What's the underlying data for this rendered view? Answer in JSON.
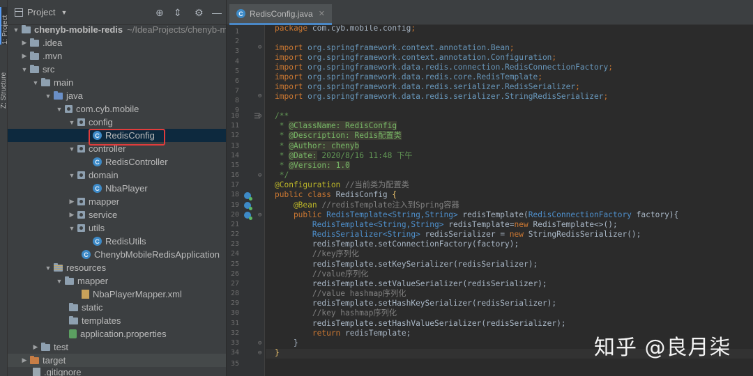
{
  "tool_strip": {
    "project_label": "1: Project",
    "structure_label": "Z: Structure"
  },
  "panel": {
    "title": "Project"
  },
  "tree": [
    {
      "label": "chenyb-mobile-redis",
      "hint": "~/IdeaProjects/chenyb-mobile-redis",
      "icon": "module-folder-icon"
    },
    {
      "label": ".idea",
      "icon": "folder-icon"
    },
    {
      "label": ".mvn",
      "icon": "folder-icon"
    },
    {
      "label": "src",
      "icon": "folder-icon"
    },
    {
      "label": "main",
      "icon": "folder-icon"
    },
    {
      "label": "java",
      "icon": "source-folder-icon"
    },
    {
      "label": "com.cyb.mobile",
      "icon": "package-icon"
    },
    {
      "label": "config",
      "icon": "package-icon"
    },
    {
      "label": "RedisConfig",
      "icon": "class-icon"
    },
    {
      "label": "controller",
      "icon": "package-icon"
    },
    {
      "label": "RedisController",
      "icon": "class-icon"
    },
    {
      "label": "domain",
      "icon": "package-icon"
    },
    {
      "label": "NbaPlayer",
      "icon": "class-icon"
    },
    {
      "label": "mapper",
      "icon": "package-icon"
    },
    {
      "label": "service",
      "icon": "package-icon"
    },
    {
      "label": "utils",
      "icon": "package-icon"
    },
    {
      "label": "RedisUtils",
      "icon": "class-icon"
    },
    {
      "label": "ChenybMobileRedisApplication",
      "icon": "spring-class-icon"
    },
    {
      "label": "resources",
      "icon": "resources-folder-icon"
    },
    {
      "label": "mapper",
      "icon": "folder-icon"
    },
    {
      "label": "NbaPlayerMapper.xml",
      "icon": "xml-file-icon"
    },
    {
      "label": "static",
      "icon": "folder-icon"
    },
    {
      "label": "templates",
      "icon": "folder-icon"
    },
    {
      "label": "application.properties",
      "icon": "properties-file-icon"
    },
    {
      "label": "test",
      "icon": "folder-icon"
    },
    {
      "label": "target",
      "icon": "target-folder-icon"
    },
    {
      "label": ".gitignore",
      "icon": "file-icon"
    }
  ],
  "editor": {
    "tab_label": "RedisConfig.java",
    "class_badge": "C",
    "line_numbers": [
      "1",
      "2",
      "3",
      "4",
      "5",
      "6",
      "7",
      "8",
      "9",
      "10",
      "11",
      "12",
      "13",
      "14",
      "15",
      "16",
      "17",
      "18",
      "19",
      "20",
      "21",
      "22",
      "23",
      "24",
      "25",
      "26",
      "27",
      "28",
      "29",
      "30",
      "31",
      "32",
      "33",
      "34",
      "35"
    ]
  },
  "code": {
    "l1": {
      "kw": "package",
      "pkg": "com.cyb.mobile.config",
      "end": ";"
    },
    "imports": [
      {
        "kw": "import",
        "pkg": "org.springframework.context.annotation.",
        "cls": "Bean",
        "end": ";"
      },
      {
        "kw": "import",
        "pkg": "org.springframework.context.annotation.",
        "cls": "Configuration",
        "end": ";"
      },
      {
        "kw": "import",
        "pkg": "org.springframework.data.redis.connection.",
        "cls": "RedisConnectionFactory",
        "end": ";"
      },
      {
        "kw": "import",
        "pkg": "org.springframework.data.redis.core.",
        "cls": "RedisTemplate",
        "end": ";"
      },
      {
        "kw": "import",
        "pkg": "org.springframework.data.redis.serializer.",
        "cls": "RedisSerializer",
        "end": ";"
      },
      {
        "kw": "import",
        "pkg": "org.springframework.data.redis.serializer.",
        "cls": "StringRedisSerializer",
        "end": ";"
      }
    ],
    "doc_open": "/**",
    "doc": [
      {
        "star": " * ",
        "tag": "@ClassName:",
        "val": " RedisConfig"
      },
      {
        "star": " * ",
        "tag": "@Description:",
        "val": " Redis配置类"
      },
      {
        "star": " * ",
        "tag": "@Author:",
        "val": " chenyb"
      },
      {
        "star": " * ",
        "tag": "@Date:",
        "val": " 2020/8/16 11:48 下午"
      },
      {
        "star": " * ",
        "tag": "@Version:",
        "val": " 1.0"
      }
    ],
    "doc_close": " */",
    "l17": {
      "ann": "@Configuration",
      "cm": " //当前类为配置类"
    },
    "l18": {
      "kw": "public class",
      "cls": " RedisConfig",
      "brace": " {"
    },
    "l19": {
      "ann": "    @Bean",
      "cm": " //redisTemplate注入到Spring容器"
    },
    "l20": {
      "kw": "    public",
      "t1": " RedisTemplate<String,String>",
      "mid": " redisTemplate(",
      "t2": "RedisConnectionFactory",
      "end": " factory){"
    },
    "l21": {
      "t1": "        RedisTemplate<String,String>",
      "mid": " redisTemplate=",
      "kw": "new",
      "end": " RedisTemplate<>();"
    },
    "l22": {
      "t1": "        RedisSerializer<String>",
      "mid": " redisSerializer = ",
      "kw": "new",
      "end": " StringRedisSerializer();"
    },
    "l23": "        redisTemplate.setConnectionFactory(factory);",
    "l24": "        //key序列化",
    "l25": "        redisTemplate.setKeySerializer(redisSerializer);",
    "l26": "        //value序列化",
    "l27": "        redisTemplate.setValueSerializer(redisSerializer);",
    "l28": "        //value hashmap序列化",
    "l29": "        redisTemplate.setHashKeySerializer(redisSerializer);",
    "l30": "        //key hashmap序列化",
    "l31": "        redisTemplate.setHashValueSerializer(redisSerializer);",
    "l32": {
      "kw": "        return",
      "end": " redisTemplate;"
    },
    "l33": "    }",
    "l34": "}"
  },
  "watermark": "知乎 @良月柒",
  "colors": {
    "accent": "#4a88c7",
    "highlight_box": "#e03c3c",
    "keyword": "#cc7832",
    "comment": "#808080"
  }
}
